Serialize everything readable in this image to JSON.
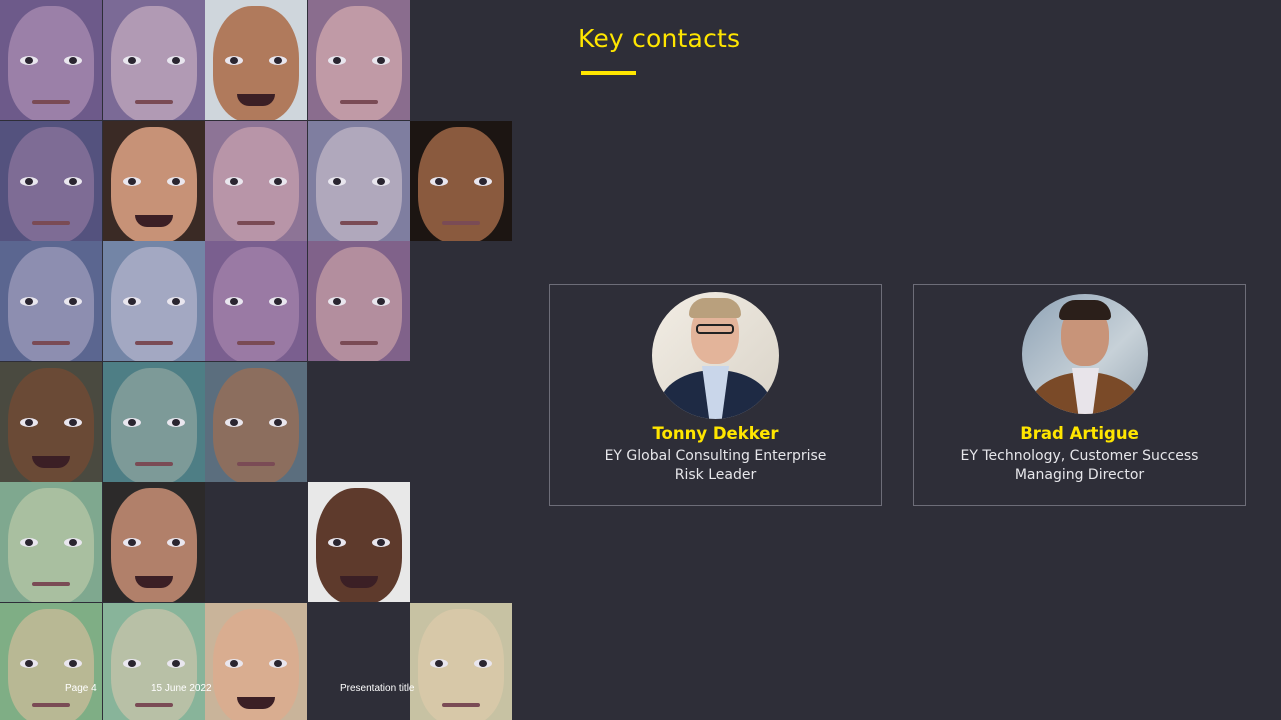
{
  "slide": {
    "title": "Key contacts",
    "accent_color": "#ffe600",
    "background_color": "#2e2e38"
  },
  "contacts": [
    {
      "name": "Tonny Dekker",
      "role_line1": "EY Global Consulting Enterprise",
      "role_line2": "Risk Leader",
      "photo": "portrait-photo"
    },
    {
      "name": "Brad Artigue",
      "role_line1": "EY Technology, Customer Success",
      "role_line2": "Managing Director",
      "photo": "portrait-photo"
    }
  ],
  "footer": {
    "page": "Page 4",
    "date": "15 June 2022",
    "presentation_title": "Presentation title"
  }
}
